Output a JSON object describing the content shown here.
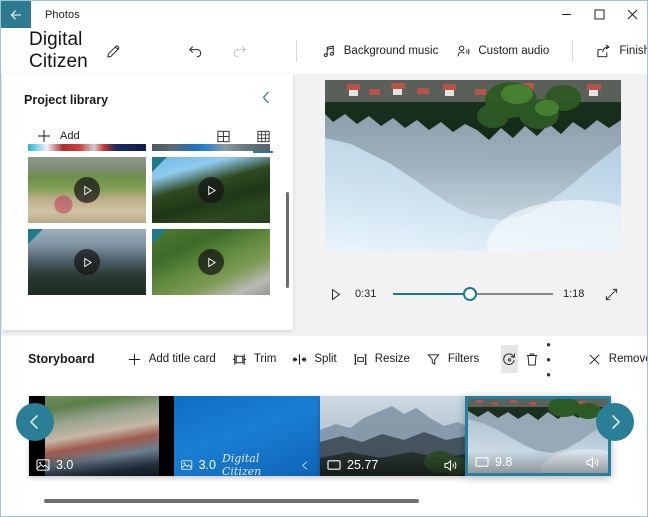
{
  "window": {
    "app_name": "Photos",
    "back_icon": "back-arrow-icon",
    "minimize_label": "─",
    "maximize_label": "□",
    "close_label": "✕"
  },
  "command_bar": {
    "project_title": "Digital Citizen",
    "edit_title_icon": "pencil-icon",
    "undo_icon": "undo-icon",
    "redo_icon": "redo-icon",
    "items": [
      {
        "label": "Background music",
        "icon": "music-note-icon"
      },
      {
        "label": "Custom audio",
        "icon": "person-audio-icon"
      },
      {
        "label": "Finish video",
        "icon": "export-share-icon"
      }
    ],
    "overflow_label": "• • •"
  },
  "library": {
    "title": "Project library",
    "collapse_icon": "chevron-left-icon",
    "add_label": "Add",
    "add_icon": "plus-icon",
    "views": [
      {
        "name": "grid-large-view",
        "icon": "grid-2x2-icon",
        "active": false
      },
      {
        "name": "grid-small-view",
        "icon": "grid-3x3-icon",
        "active": true
      }
    ],
    "thumbnails": [
      {
        "name": "clip-child-swing",
        "play_icon": "play-icon"
      },
      {
        "name": "clip-forest-sky",
        "play_icon": "play-icon"
      },
      {
        "name": "clip-mountain-haze",
        "play_icon": "play-icon"
      },
      {
        "name": "clip-forest-road",
        "play_icon": "play-icon"
      }
    ]
  },
  "preview": {
    "play_icon": "play-icon",
    "current_time": "0:31",
    "total_time": "1:18",
    "progress_percent": 40,
    "fullscreen_icon": "expand-icon",
    "frame_name": "lake-mountain-reflection-upside-down"
  },
  "storyboard": {
    "title": "Storyboard",
    "tools": [
      {
        "label": "Add title card",
        "icon": "plus-icon",
        "name": "add-title-card-button"
      },
      {
        "label": "Trim",
        "icon": "trim-icon",
        "name": "trim-button"
      },
      {
        "label": "Split",
        "icon": "split-icon",
        "name": "split-button"
      },
      {
        "label": "Resize",
        "icon": "resize-icon",
        "name": "resize-button"
      },
      {
        "label": "Filters",
        "icon": "filters-icon",
        "name": "filters-button"
      }
    ],
    "rotate_icon": "rotate-icon",
    "delete_icon": "trash-icon",
    "overflow_label": "• • •",
    "remove_all_label": "Remove all",
    "remove_all_icon": "close-x-icon",
    "prev_icon": "chevron-left-icon",
    "next_icon": "chevron-right-icon",
    "clips": [
      {
        "name": "clip-three-cyclists",
        "duration": "3.0",
        "type_icon": "photo-icon",
        "audio_icon": "",
        "selected": false,
        "title_card": false
      },
      {
        "name": "clip-title-card-digital-citizen",
        "duration": "3.0",
        "type_icon": "photo-icon",
        "card_text": "Digital Citizen",
        "card_corner_icon": "chevron-left-icon",
        "audio_icon": "",
        "selected": false,
        "title_card": true
      },
      {
        "name": "clip-mountain-ridge",
        "duration": "25.77",
        "type_icon": "video-icon",
        "audio_icon": "speaker-icon",
        "selected": false,
        "title_card": false
      },
      {
        "name": "clip-lake-reflection",
        "duration": "9.8",
        "type_icon": "video-icon",
        "audio_icon": "speaker-icon",
        "selected": true,
        "title_card": false
      }
    ]
  },
  "colors": {
    "accent_teal": "#2e7b91",
    "selection_border": "#2380a0",
    "slider_fill": "#1a7a94",
    "title_card_blue": "#0c6cc4"
  }
}
